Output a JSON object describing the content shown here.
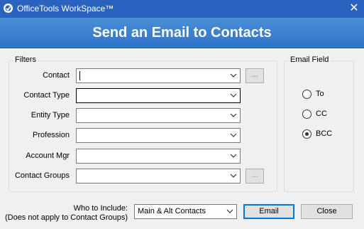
{
  "window": {
    "title": "OfficeTools WorkSpace™"
  },
  "banner": {
    "title": "Send an Email to Contacts"
  },
  "filters": {
    "legend": "Filters",
    "rows": [
      {
        "label": "Contact",
        "value": "",
        "has_browse": true
      },
      {
        "label": "Contact Type",
        "value": "",
        "has_browse": false
      },
      {
        "label": "Entity Type",
        "value": "",
        "has_browse": false
      },
      {
        "label": "Profession",
        "value": "",
        "has_browse": false
      },
      {
        "label": "Account Mgr",
        "value": "",
        "has_browse": false
      },
      {
        "label": "Contact Groups",
        "value": "",
        "has_browse": true
      }
    ],
    "browse_label": "..."
  },
  "email_field": {
    "legend": "Email Field",
    "options": [
      {
        "label": "To",
        "checked": false
      },
      {
        "label": "CC",
        "checked": false
      },
      {
        "label": "BCC",
        "checked": true
      }
    ]
  },
  "footer": {
    "who_label_line1": "Who to Include:",
    "who_label_line2": "(Does not apply to Contact Groups)",
    "who_value": "Main & Alt Contacts",
    "email_button": "Email",
    "close_button": "Close"
  },
  "colors": {
    "titlebar": "#2b62c0",
    "banner": "#3a7fd0",
    "focus_border": "#0078d7"
  },
  "icons": {
    "app": "officetools-logo-icon",
    "close": "close-icon",
    "dropdown": "chevron-down-icon"
  }
}
